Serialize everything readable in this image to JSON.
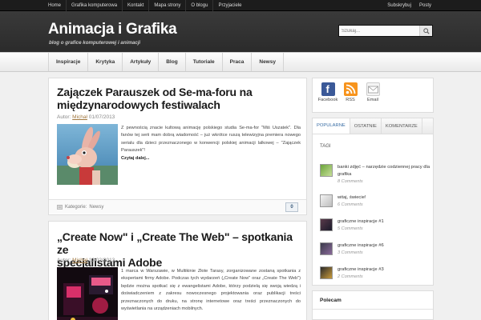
{
  "top_nav": {
    "items": [
      "Home",
      "Grafika komputerowa",
      "Kontakt",
      "Mapa strony",
      "O blogu",
      "Przyjaciele"
    ],
    "subscribe": "Subskrybuj",
    "posts": "Posty"
  },
  "header": {
    "title": "Animacja i Grafika",
    "tagline": "blog o grafice komputerowej i animacji",
    "search_placeholder": "Szukaj..."
  },
  "main_nav": [
    "Inspiracje",
    "Krytyka",
    "Artykuły",
    "Blog",
    "Tutoriale",
    "Praca",
    "Newsy"
  ],
  "posts": [
    {
      "title_line1": "Zajączek Parauszek od Se-ma-foru na",
      "title_line2": "międzynarodowych festiwalach",
      "meta_prefix": "Autor:",
      "author": "Michał",
      "date": "01/07/2013",
      "excerpt": "Z pewnością znacie kultową animację polskiego studia Se-ma-for \"Miś Uszatek\". Dla fanów tej serii mam dobrą wiadomość – już wkrótce ruszą telewizyjna premiera nowego serialu dla dzieci przeznaczonego w konwencji polskiej animacji lalkowej – \"Zajączek Parauszek\"!",
      "read_more": "Czytaj dalej...",
      "category_prefix": "Kategorie:",
      "category": "Newsy",
      "comments": "0"
    },
    {
      "title_line1": "„Create Now\" i „Create The Web\" – spotkania ze",
      "title_line2": "specjalistami Adobe",
      "meta_prefix": "Autor:",
      "author": "Michał",
      "date": "13/02/2013",
      "excerpt": "1 marca w Warszawie, w Multikinie Złote Tarasy, zorganizowane zostaną spotkania z ekspertami firmy Adobe. Podczas tych wydarzeń („Create Now\" oraz „Create The Web\") będzie można spotkać się z ewangelistami Adobe, którzy podzielą się swoją wiedzą i doświadczeniem z zakresu nowoczesnego projektowania oraz publikacji treści przeznaczonych do druku, na stronę internetowe oraz treści przeznaczonych do wyświetlania na urządzeniach mobilnych."
    }
  ],
  "social": [
    {
      "label": "Facebook",
      "icon": "facebook-icon",
      "color": "#3b5998"
    },
    {
      "label": "RSS",
      "icon": "rss-icon",
      "color": "#f7941d"
    },
    {
      "label": "Email",
      "icon": "email-icon",
      "color": "#dcdcdc"
    }
  ],
  "tabs": [
    "POPULARNE",
    "OSTATNIE",
    "KOMENTARZE"
  ],
  "tags_label": "TAGI",
  "popular": [
    {
      "title": "banki zdjęć – narzędzie codziennej pracy dla grafika",
      "comments": "8 Comments"
    },
    {
      "title": "witaj, świecie!",
      "comments": "6 Comments"
    },
    {
      "title": "graficzne inspiracje #1",
      "comments": "5 Comments"
    },
    {
      "title": "graficzne inspiracje #6",
      "comments": "3 Comments"
    },
    {
      "title": "graficzne inspiracje #3",
      "comments": "2 Comments"
    }
  ],
  "polecam": "Polecam",
  "colors": {
    "accent": "#3a6ea5",
    "author": "#a07840",
    "header_bg": "#2f2f2f"
  }
}
